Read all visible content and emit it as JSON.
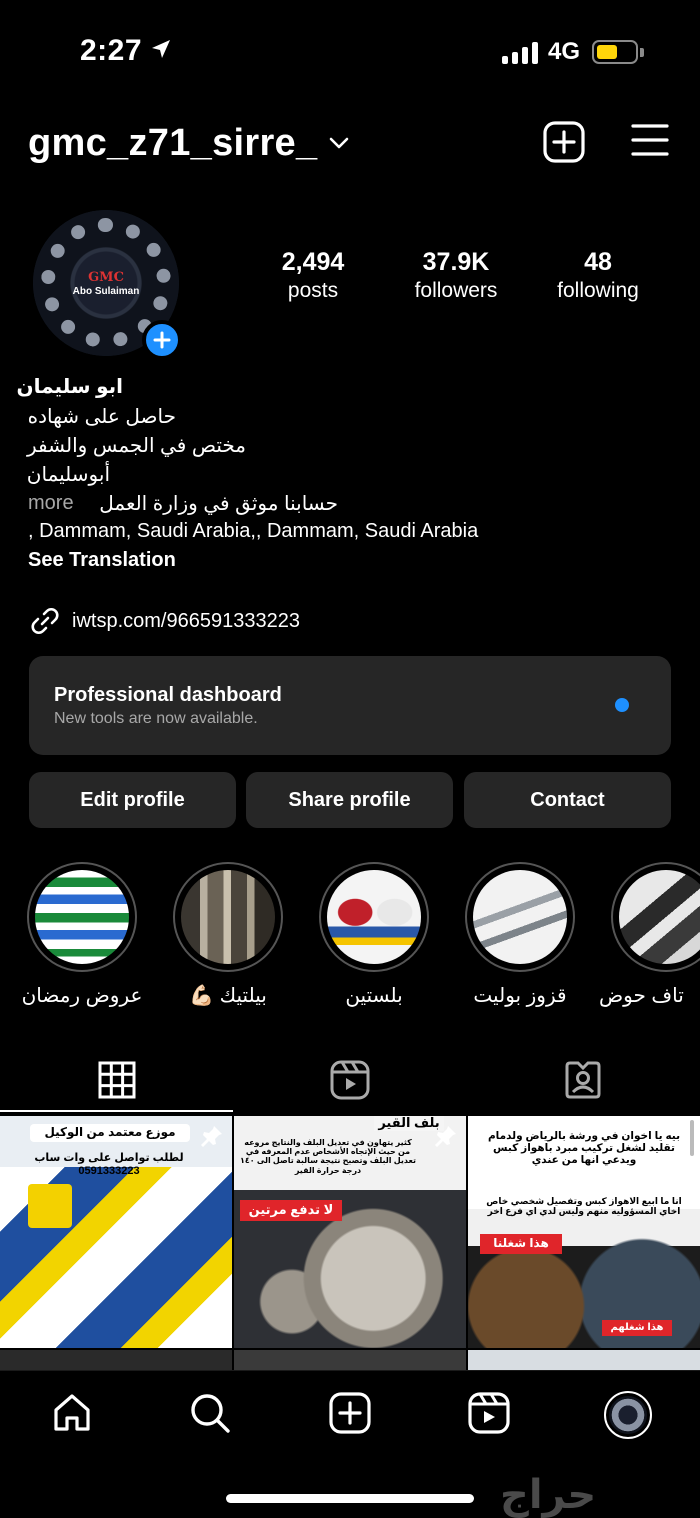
{
  "status_bar": {
    "time": "2:27",
    "network": "4G"
  },
  "header": {
    "username": "gmc_z71_sirre_"
  },
  "profile": {
    "avatar_brand": "GMC",
    "avatar_sub": "Abo Sulaiman",
    "stats": [
      {
        "value": "2,494",
        "label": "posts"
      },
      {
        "value": "37.9K",
        "label": "followers"
      },
      {
        "value": "48",
        "label": "following"
      }
    ],
    "bio": {
      "name": "ابو سليمان",
      "line1": "حاصل على شهاده",
      "line2": "مختص في الجمس والشفر",
      "line3": "أبوسليمان",
      "line4": "حسابنا موثق في وزارة العمل",
      "more": "more",
      "location": ", Dammam, Saudi Arabia,, Dammam, Saudi Arabia",
      "see_translation": "See Translation"
    },
    "link": "iwtsp.com/966591333223"
  },
  "dashboard": {
    "title": "Professional dashboard",
    "subtitle": "New tools are now available."
  },
  "actions": {
    "edit": "Edit profile",
    "share": "Share profile",
    "contact": "Contact"
  },
  "highlights": [
    {
      "label": "عروض رمضان"
    },
    {
      "label": "بيلتيك 💪🏻"
    },
    {
      "label": "بلستين"
    },
    {
      "label": "قزوز بوليت"
    },
    {
      "label": "تاف حوض"
    }
  ],
  "posts": {
    "p1_title": "موزع معتمد من الوكيل",
    "p1_sub": "لطلب تواصل على وات ساب 0591333223",
    "p2_title": "بلف القير",
    "p2_body": "كثير يتهاون في تعديل البلف والنتايج مروعه من حيث الإتجاه الأشخاص عدم المعرفه في تعديل البلف وتصبح نتيجة سالبة تاصل الى ١٤٠ درجة حرارة القير",
    "p2_badge": "لا تدفع مرتين",
    "p3_title": "بيه يا اخوان في ورشة بالرياض ولدمام تقليد لشغل تركيب مبرد باهواز كبس ويدعي انها من عندي",
    "p3_body": "انا ما ابيع الاهواز كبس وتفصيل شخصي خاص اخاي المسؤوليه منهم وليس لدي اي فرع اخر",
    "p3_badge": "هذا شغلنا",
    "p3_badge2": "هذا شغلهم"
  },
  "watermark": "حراج",
  "colors": {
    "background": "#000000",
    "card": "#262626",
    "accent": "#1e90ff",
    "muted": "#a8a8a8"
  },
  "icons": [
    "location-arrow-icon",
    "chevron-down-icon",
    "plus-square-icon",
    "menu-icon",
    "link-icon",
    "grid-icon",
    "reels-icon",
    "tagged-icon",
    "home-icon",
    "search-icon",
    "create-icon",
    "pin-icon"
  ]
}
